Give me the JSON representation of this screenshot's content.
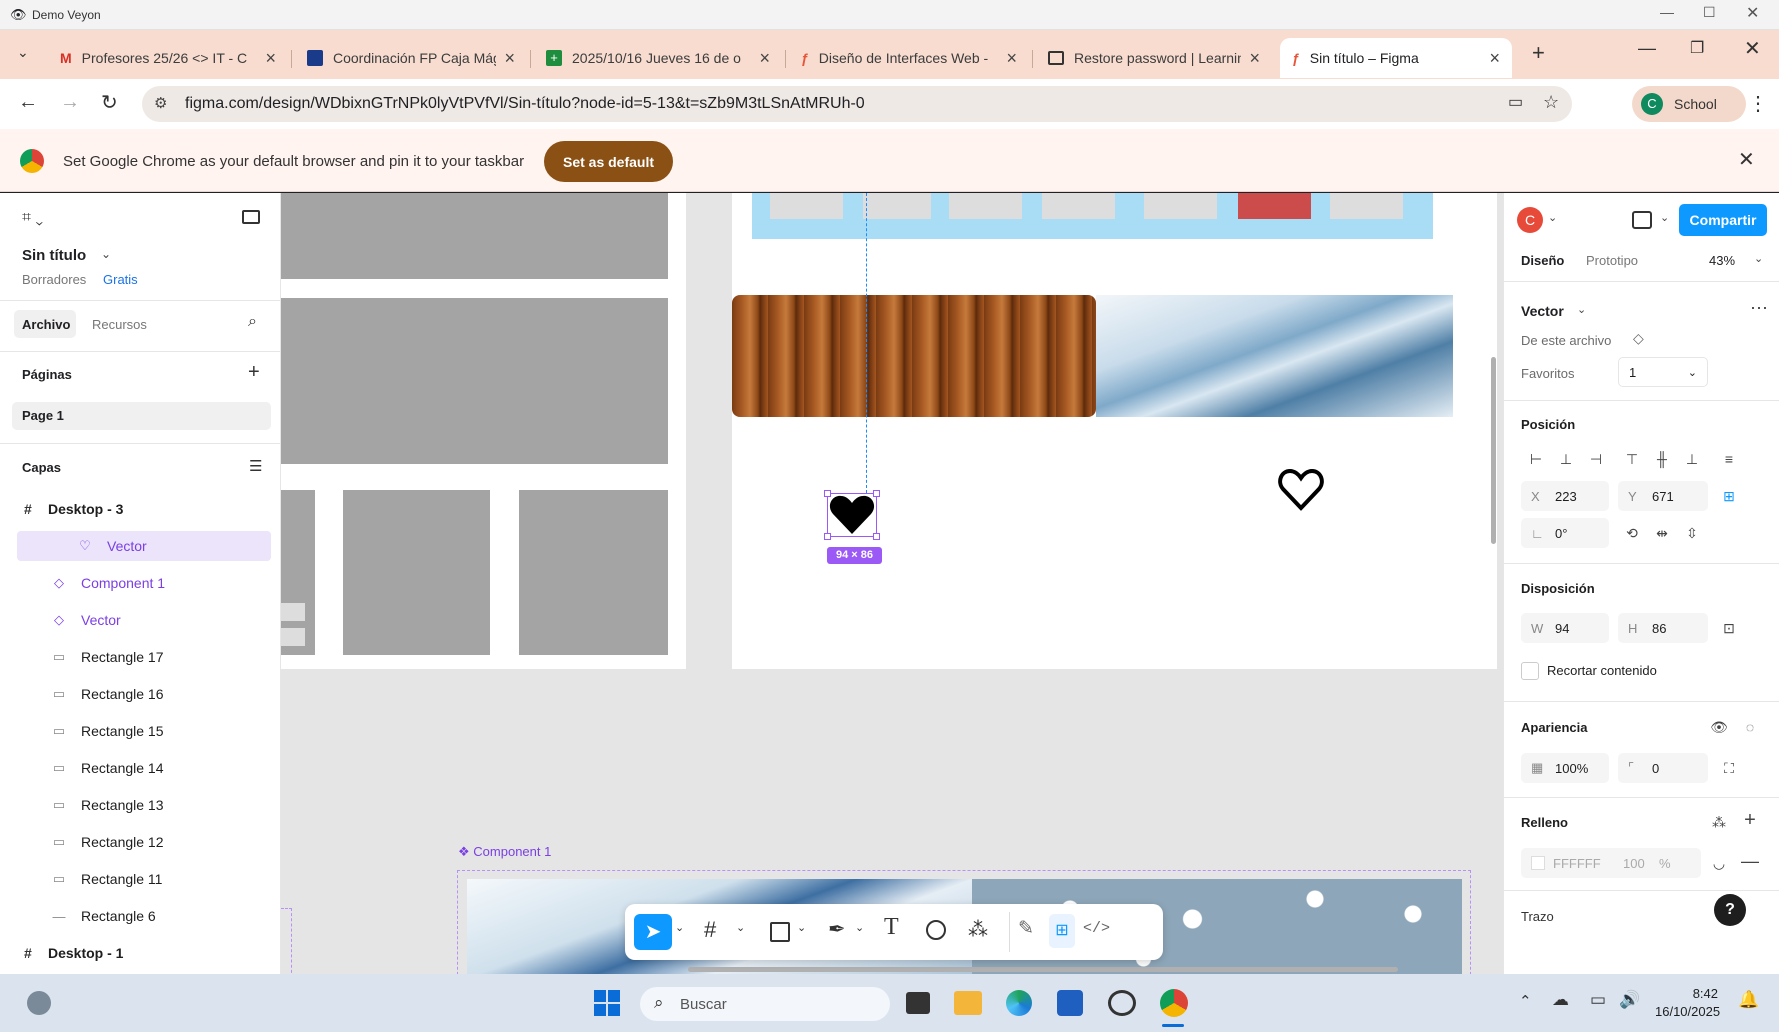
{
  "window": {
    "title": "Demo Veyon"
  },
  "tabs": [
    {
      "label": "Profesores 25/26 <> IT - C",
      "icon": "gmail-icon"
    },
    {
      "label": "Coordinación FP Caja Mági",
      "icon": "docs-icon"
    },
    {
      "label": "2025/10/16 Jueves 16 de o",
      "icon": "sheets-icon"
    },
    {
      "label": "Diseño de Interfaces Web -",
      "icon": "figma-icon"
    },
    {
      "label": "Restore password | Learnin",
      "icon": "page-icon"
    },
    {
      "label": "Sin título – Figma",
      "icon": "figma-icon",
      "active": true
    }
  ],
  "address": {
    "url": "figma.com/design/WDbixnGTrNPk0lyVtPVfVl/Sin-título?node-id=5-13&t=sZb9M3tLSnAtMRUh-0",
    "profile_initial": "C",
    "profile_label": "School"
  },
  "infobar": {
    "message": "Set Google Chrome as your default browser and pin it to your taskbar",
    "button": "Set as default"
  },
  "left": {
    "file_name": "Sin título",
    "location": "Borradores",
    "plan": "Gratis",
    "tabs": [
      "Archivo",
      "Recursos"
    ],
    "pages_title": "Páginas",
    "pages": [
      "Page 1"
    ],
    "layers_title": "Capas",
    "layers": [
      {
        "name": "Desktop - 3",
        "icon": "#",
        "type": "frame"
      },
      {
        "name": "Vector",
        "icon": "♡",
        "type": "selected"
      },
      {
        "name": "Component 1",
        "icon": "◇",
        "type": "component"
      },
      {
        "name": "Vector",
        "icon": "◇",
        "type": "component"
      },
      {
        "name": "Rectangle 17",
        "icon": "▭",
        "type": "rect"
      },
      {
        "name": "Rectangle 16",
        "icon": "▭",
        "type": "rect"
      },
      {
        "name": "Rectangle 15",
        "icon": "▭",
        "type": "rect"
      },
      {
        "name": "Rectangle 14",
        "icon": "▭",
        "type": "rect"
      },
      {
        "name": "Rectangle 13",
        "icon": "▭",
        "type": "rect"
      },
      {
        "name": "Rectangle 12",
        "icon": "▭",
        "type": "rect"
      },
      {
        "name": "Rectangle 11",
        "icon": "▭",
        "type": "rect"
      },
      {
        "name": "Rectangle 6",
        "icon": "—",
        "type": "rect"
      },
      {
        "name": "Desktop - 1",
        "icon": "#",
        "type": "frame"
      }
    ]
  },
  "canvas": {
    "selection_size": "94 × 86",
    "component_label": "Component 1"
  },
  "right": {
    "avatar_initial": "C",
    "share": "Compartir",
    "tabs": [
      "Diseño",
      "Prototipo"
    ],
    "zoom": "43%",
    "layer_name": "Vector",
    "from_file": "De este archivo",
    "favorites_label": "Favoritos",
    "favorites_value": "1",
    "position_title": "Posición",
    "x": "223",
    "y": "671",
    "rotation": "0°",
    "layout_title": "Disposición",
    "w": "94",
    "h": "86",
    "clip": "Recortar contenido",
    "appearance_title": "Apariencia",
    "opacity": "100%",
    "radius": "0",
    "fill_title": "Relleno",
    "fill_hex": "FFFFFF",
    "fill_opacity": "100",
    "fill_pct": "%",
    "stroke_title": "Trazo"
  },
  "taskbar": {
    "search": "Buscar",
    "time": "8:42",
    "date": "16/10/2025"
  }
}
